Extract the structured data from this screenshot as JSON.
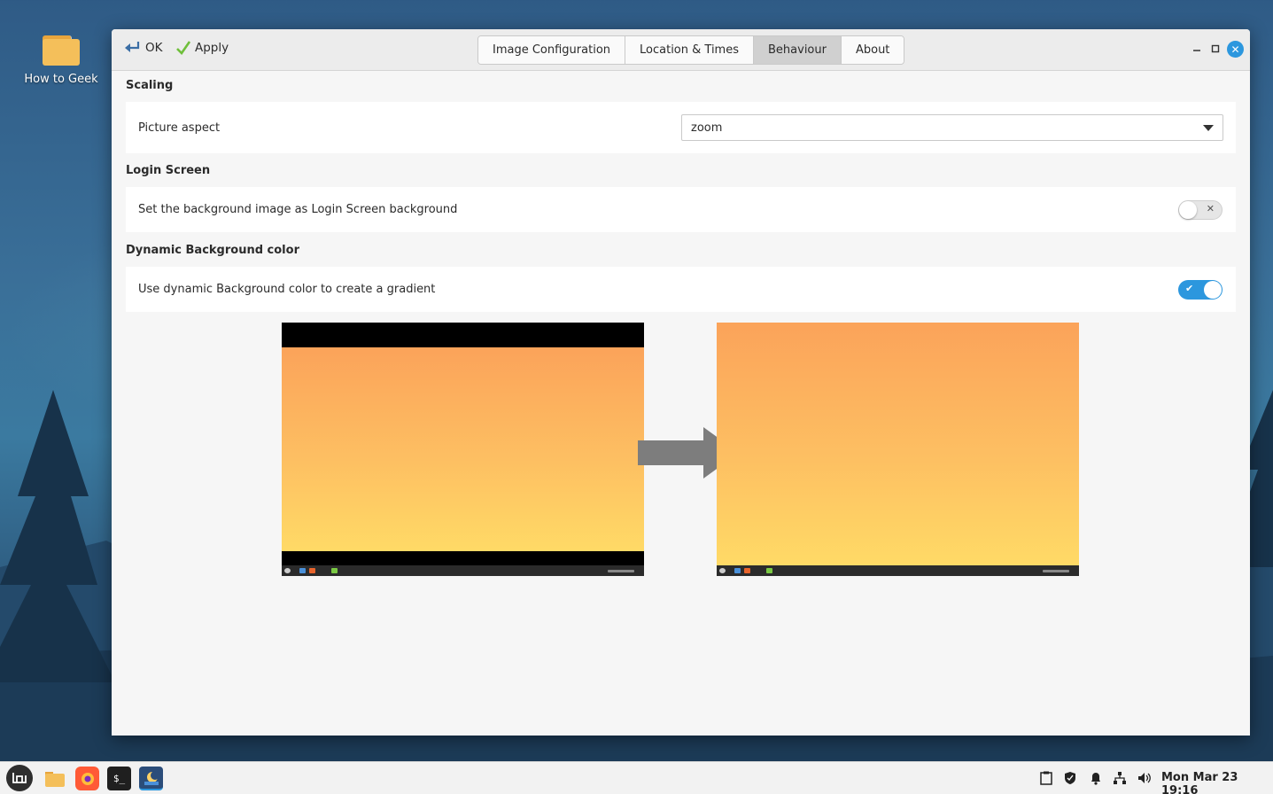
{
  "desktop": {
    "icons": [
      {
        "label": "How to Geek",
        "icon": "folder-icon"
      }
    ]
  },
  "window": {
    "headerbar": {
      "ok_label": "OK",
      "apply_label": "Apply",
      "tabs": [
        {
          "label": "Image Configuration",
          "active": false
        },
        {
          "label": "Location & Times",
          "active": false
        },
        {
          "label": "Behaviour",
          "active": true
        },
        {
          "label": "About",
          "active": false
        }
      ],
      "controls": [
        "minimize-icon",
        "maximize-icon",
        "close-icon"
      ]
    },
    "sections": {
      "scaling": {
        "title": "Scaling",
        "picture_aspect_label": "Picture aspect",
        "picture_aspect_value": "zoom"
      },
      "login_screen": {
        "title": "Login Screen",
        "label": "Set the background image as Login Screen background",
        "enabled": false
      },
      "dynamic_bg": {
        "title": "Dynamic Background color",
        "label": "Use dynamic Background color to create a gradient",
        "enabled": true
      }
    },
    "preview": {
      "before": "letterboxed-wallpaper-preview",
      "after": "gradient-filled-wallpaper-preview",
      "arrow": "right-arrow-icon"
    }
  },
  "panel": {
    "launchers": [
      "mint-menu-icon",
      "files-icon",
      "firefox-icon",
      "terminal-icon",
      "wallpaper-app-icon"
    ],
    "tray": [
      "clipboard-icon",
      "shield-icon",
      "notification-bell-icon",
      "network-icon",
      "volume-icon"
    ],
    "clock": "Mon Mar 23 19:16"
  },
  "colors": {
    "accent": "#2c97de",
    "gradient_top": "#fba35a",
    "gradient_bottom": "#ffda66"
  }
}
